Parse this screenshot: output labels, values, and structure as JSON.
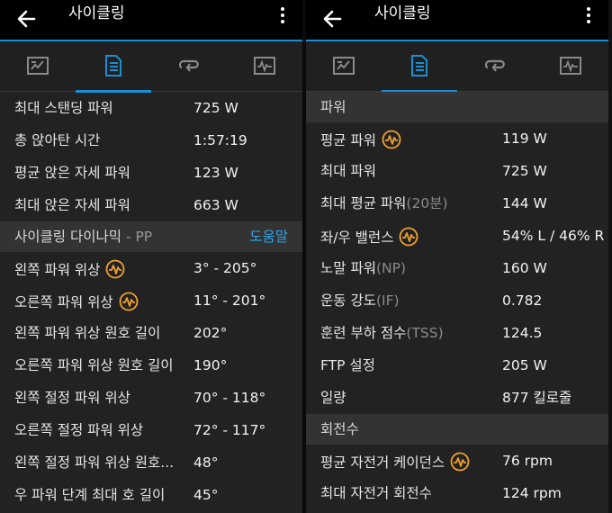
{
  "app": {
    "title": "사이클링"
  },
  "icons": {
    "back": "arrow-left-icon",
    "more": "more-vert-icon",
    "tabs": [
      "summary-chart-icon",
      "details-list-icon",
      "laps-loop-icon",
      "graph-chart-icon"
    ],
    "dynamics": "cycling-dynamics-icon"
  },
  "colors": {
    "accent": "#1a8fd6",
    "link": "#2ea3e6",
    "dynamics_icon": "#f0a030"
  },
  "left_panel": {
    "rows": [
      {
        "label": "최대 스탠딩 파워",
        "value": "725 W"
      },
      {
        "label": "총 앉아탄 시간",
        "value": "1:57:19"
      },
      {
        "label": "평균 앉은 자세 파워",
        "value": "123 W"
      },
      {
        "label": "최대 앉은 자세 파워",
        "value": "663 W"
      }
    ],
    "dynamics_section": {
      "label": "사이클링 다이나믹",
      "suffix": " - PP",
      "help_link": "도움말"
    },
    "dynamics_rows": [
      {
        "label": "왼쪽 파워 위상",
        "value": "3° - 205°"
      },
      {
        "label": "오른쪽 파워 위상",
        "value": "11° - 201°"
      },
      {
        "label": "왼쪽 파워 위상 원호 길이",
        "value": "202°"
      },
      {
        "label": "오른쪽 파워 위상 원호 길이",
        "value": "190°"
      },
      {
        "label": "왼쪽 절정 파워 위상",
        "value": "70° - 118°"
      },
      {
        "label": "오른쪽 절정 파워 위상",
        "value": "72° - 117°"
      },
      {
        "label": "왼쪽 절정 파워 위상 원호...",
        "value": "48°"
      },
      {
        "label": "우 파워 단계 최대 호 길이",
        "value": "45°"
      }
    ]
  },
  "right_panel": {
    "power_section": "파워",
    "power_rows": [
      {
        "label": "평균 파워",
        "value": "119 W"
      },
      {
        "label": "최대 파워",
        "value": "725 W"
      },
      {
        "label": "최대 평균 파워",
        "label_dim": "(20분)",
        "value": "144 W"
      },
      {
        "label": "좌/우 밸런스",
        "value": "54% L / 46% R"
      },
      {
        "label": "노말 파워",
        "label_dim": "(NP)",
        "value": "160 W"
      },
      {
        "label": "운동 강도",
        "label_dim": "(IF)",
        "value": "0.782"
      },
      {
        "label": "훈련 부하 점수",
        "label_dim": "(TSS)",
        "value": "124.5"
      },
      {
        "label": "FTP 설정",
        "value": "205 W"
      },
      {
        "label": "일량",
        "value": "877 킬로줄"
      }
    ],
    "cadence_section": "회전수",
    "cadence_rows": [
      {
        "label": "평균 자전거 케이던스",
        "value": "76 rpm"
      },
      {
        "label": "최대 자전거 회전수",
        "value": "124 rpm"
      }
    ]
  }
}
